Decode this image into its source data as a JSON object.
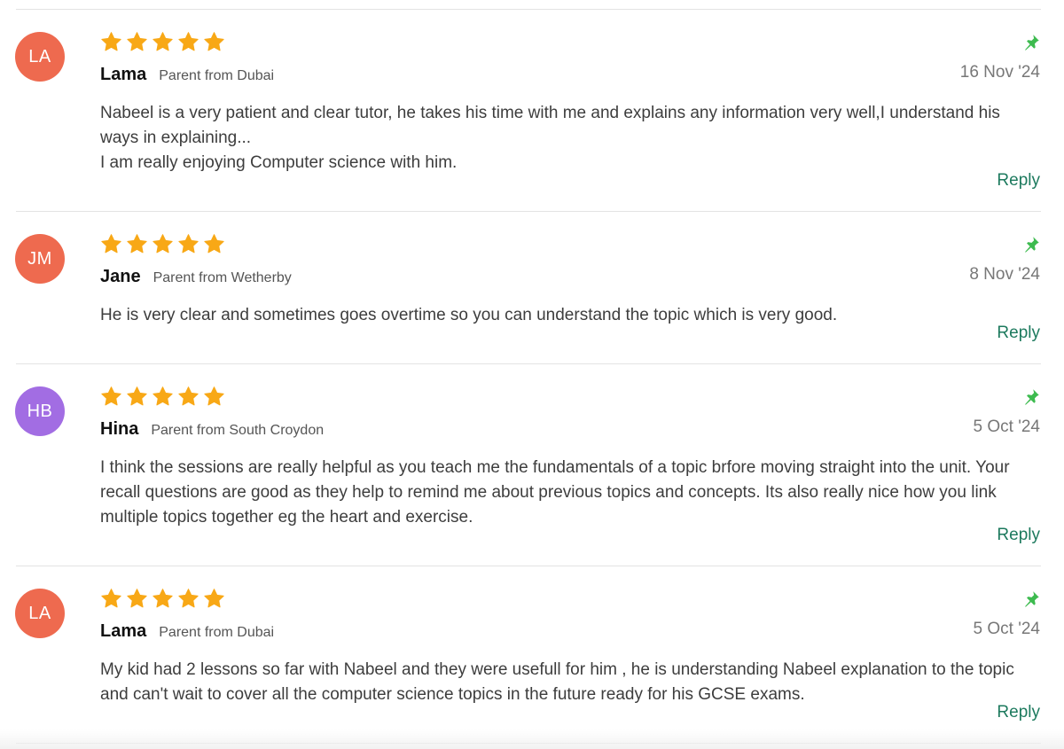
{
  "colors": {
    "star": "#f8a816",
    "pin": "#3dbb4f",
    "reply": "#1d7a5e",
    "avatar_orange": "#ee6a4f",
    "avatar_purple": "#a26de3"
  },
  "icons": {
    "star": "star-icon",
    "pin": "pin-icon"
  },
  "reviews": [
    {
      "initials": "LA",
      "avatar_color": "#ee6a4f",
      "rating": 5,
      "name": "Lama",
      "origin": "Parent from Dubai",
      "date": "16 Nov '24",
      "text": "Nabeel is a very patient and clear tutor, he takes his time with me and explains any information very well,I understand his ways in explaining...\nI am really enjoying Computer science with him.",
      "reply_label": "Reply"
    },
    {
      "initials": "JM",
      "avatar_color": "#ee6a4f",
      "rating": 5,
      "name": "Jane",
      "origin": "Parent from Wetherby",
      "date": "8 Nov '24",
      "text": "He is very clear and sometimes goes overtime so you can understand the topic which is very good.",
      "reply_label": "Reply"
    },
    {
      "initials": "HB",
      "avatar_color": "#a26de3",
      "rating": 5,
      "name": "Hina",
      "origin": "Parent from South Croydon",
      "date": "5 Oct '24",
      "text": "I think the sessions are really helpful as you teach me the fundamentals of a topic brfore moving straight into the unit. Your recall questions are good as they help to remind me about previous topics and concepts. Its also really nice how you link multiple topics together eg the heart and exercise.",
      "reply_label": "Reply"
    },
    {
      "initials": "LA",
      "avatar_color": "#ee6a4f",
      "rating": 5,
      "name": "Lama",
      "origin": "Parent from Dubai",
      "date": "5 Oct '24",
      "text": "My kid had 2 lessons so far with Nabeel and they were usefull for him , he is understanding Nabeel explanation to the topic and can't wait to cover all the computer science topics in the future ready for his GCSE exams.",
      "reply_label": "Reply"
    }
  ]
}
